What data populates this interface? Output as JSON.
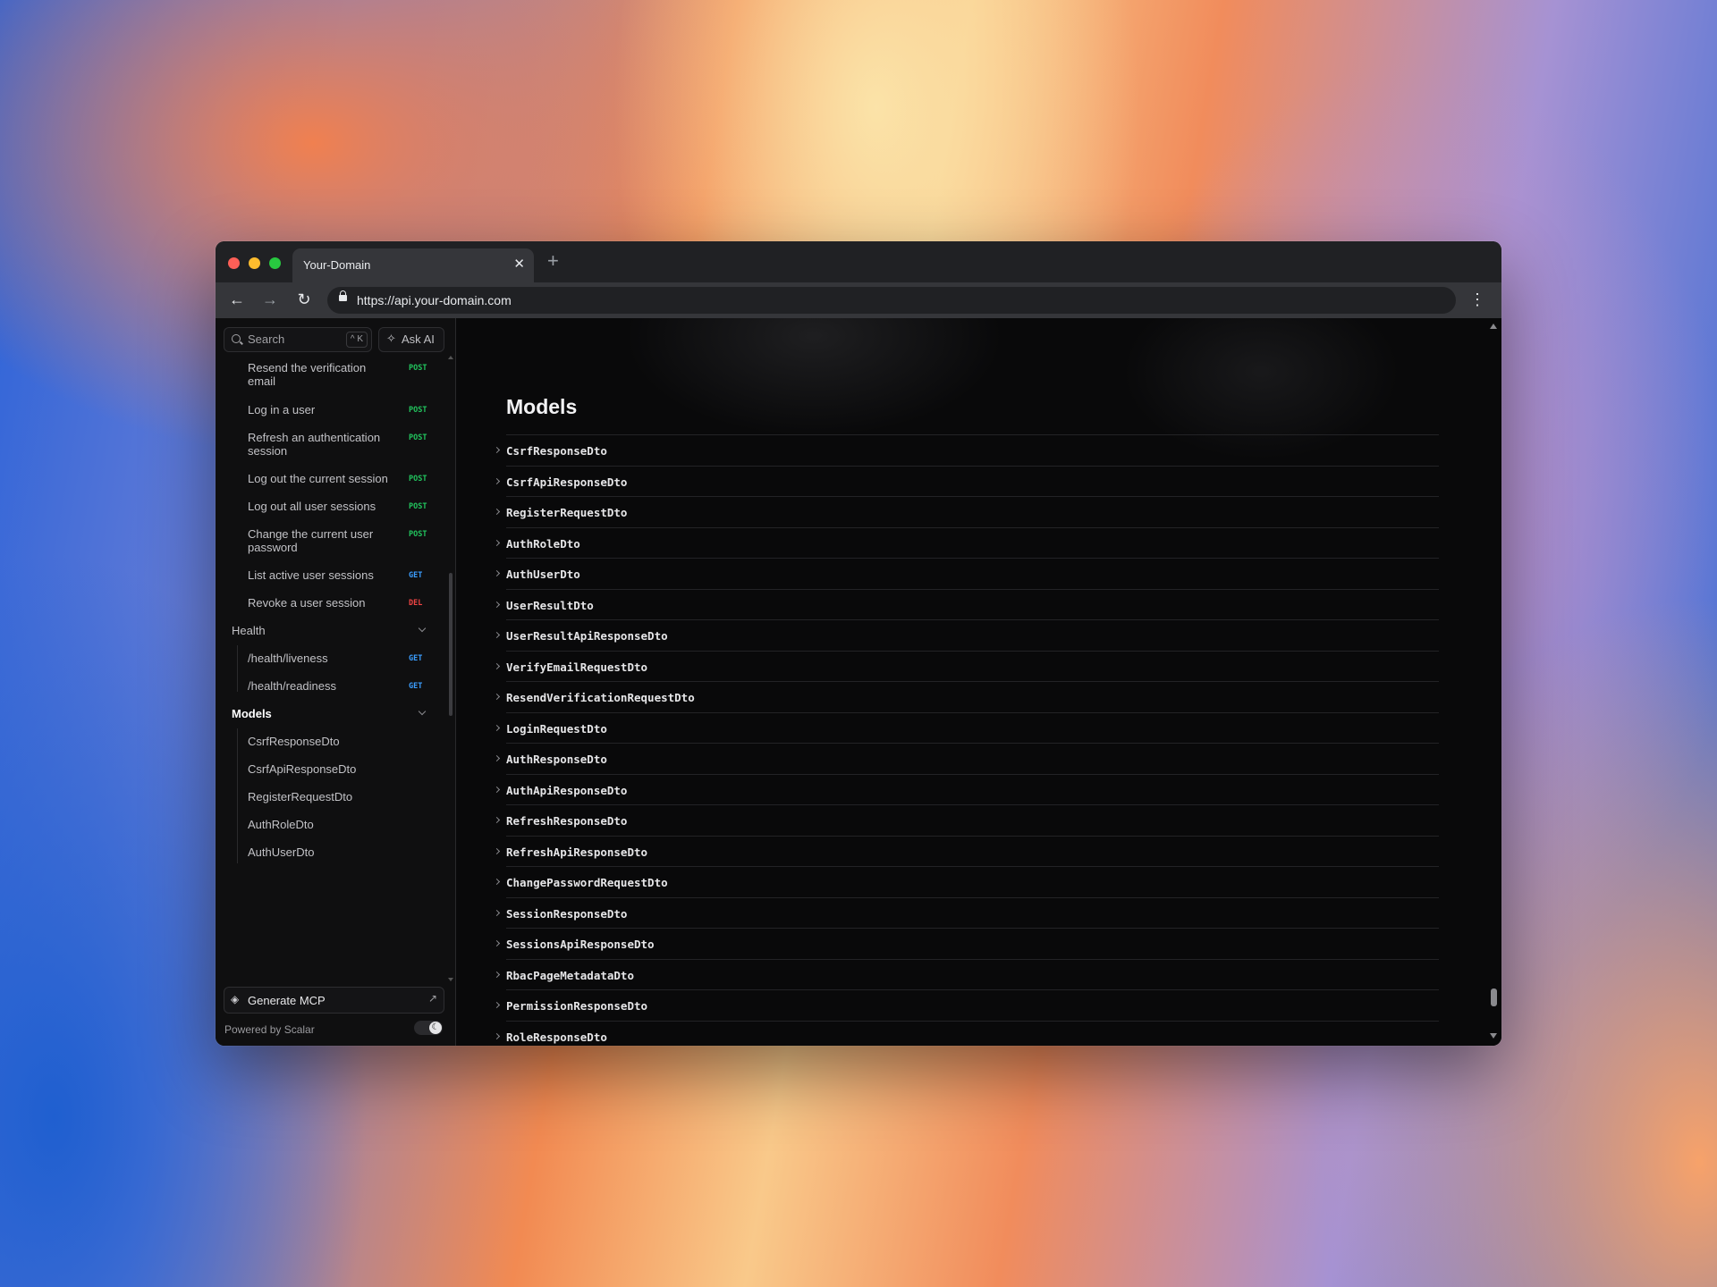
{
  "browser": {
    "tab_title": "Your-Domain",
    "tab_close": "✕",
    "new_tab": "+",
    "url": "https://api.your-domain.com",
    "back": "←",
    "forward": "→",
    "reload": "↻",
    "menu": "⋮"
  },
  "sidebar": {
    "search_placeholder": "Search",
    "search_shortcut": "^ K",
    "ask_ai_label": "Ask AI",
    "items": [
      {
        "label": "Resend the verification email",
        "method": "POST"
      },
      {
        "label": "Log in a user",
        "method": "POST"
      },
      {
        "label": "Refresh an authentication session",
        "method": "POST"
      },
      {
        "label": "Log out the current session",
        "method": "POST"
      },
      {
        "label": "Log out all user sessions",
        "method": "POST"
      },
      {
        "label": "Change the current user password",
        "method": "POST"
      },
      {
        "label": "List active user sessions",
        "method": "GET"
      },
      {
        "label": "Revoke a user session",
        "method": "DEL"
      }
    ],
    "health": {
      "label": "Health",
      "items": [
        {
          "label": "/health/liveness",
          "method": "GET"
        },
        {
          "label": "/health/readiness",
          "method": "GET"
        }
      ]
    },
    "models": {
      "label": "Models",
      "items": [
        "CsrfResponseDto",
        "CsrfApiResponseDto",
        "RegisterRequestDto",
        "AuthRoleDto",
        "AuthUserDto",
        "UserResultDto",
        "UserResultApiResponseDto",
        "VerifyEmailRequestDto",
        "ResendVerificationRequestDto"
      ]
    },
    "generate_mcp": "Generate MCP",
    "powered_by": "Powered by Scalar"
  },
  "main": {
    "title": "Models",
    "models": [
      "CsrfResponseDto",
      "CsrfApiResponseDto",
      "RegisterRequestDto",
      "AuthRoleDto",
      "AuthUserDto",
      "UserResultDto",
      "UserResultApiResponseDto",
      "VerifyEmailRequestDto",
      "ResendVerificationRequestDto",
      "LoginRequestDto",
      "AuthResponseDto",
      "AuthApiResponseDto",
      "RefreshResponseDto",
      "RefreshApiResponseDto",
      "ChangePasswordRequestDto",
      "SessionResponseDto",
      "SessionsApiResponseDto",
      "RbacPageMetadataDto",
      "PermissionResponseDto",
      "RoleResponseDto"
    ]
  }
}
